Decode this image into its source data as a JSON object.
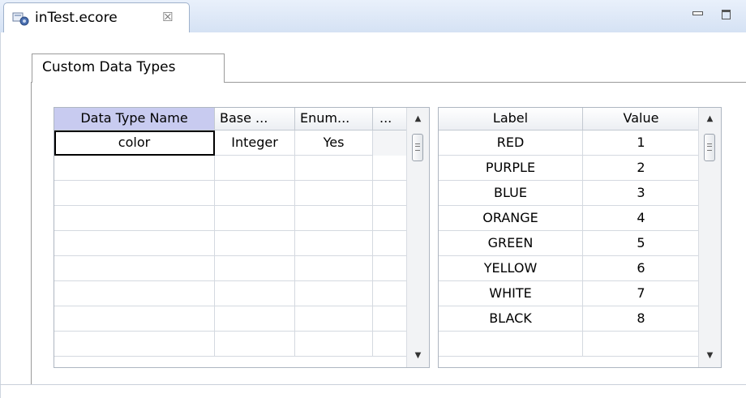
{
  "editor": {
    "tab_title": "inTest.ecore",
    "close_glyph": "☒",
    "page_tab_label": "Custom Data Types"
  },
  "types_table": {
    "columns": [
      "Data Type Name",
      "Base ...",
      "Enum...",
      "..."
    ],
    "rows": [
      [
        "color",
        "Integer",
        "Yes",
        ""
      ],
      [
        "",
        "",
        "",
        ""
      ],
      [
        "",
        "",
        "",
        ""
      ],
      [
        "",
        "",
        "",
        ""
      ],
      [
        "",
        "",
        "",
        ""
      ],
      [
        "",
        "",
        "",
        ""
      ],
      [
        "",
        "",
        "",
        ""
      ],
      [
        "",
        "",
        "",
        ""
      ],
      [
        "",
        "",
        "",
        ""
      ]
    ]
  },
  "enum_table": {
    "columns": [
      "Label",
      "Value"
    ],
    "rows": [
      [
        "RED",
        "1"
      ],
      [
        "PURPLE",
        "2"
      ],
      [
        "BLUE",
        "3"
      ],
      [
        "ORANGE",
        "4"
      ],
      [
        "GREEN",
        "5"
      ],
      [
        "YELLOW",
        "6"
      ],
      [
        "WHITE",
        "7"
      ],
      [
        "BLACK",
        "8"
      ],
      [
        "",
        ""
      ]
    ]
  },
  "icons": {
    "file": "ecore-file-icon",
    "close": "close-icon",
    "minimize": "minimize-icon",
    "maximize": "maximize-icon",
    "scroll_up": "scroll-up-arrow-icon",
    "scroll_down": "scroll-down-arrow-icon"
  },
  "colors": {
    "selected_header": "#c8cbf0",
    "title_bar": "#d5e2f4"
  }
}
